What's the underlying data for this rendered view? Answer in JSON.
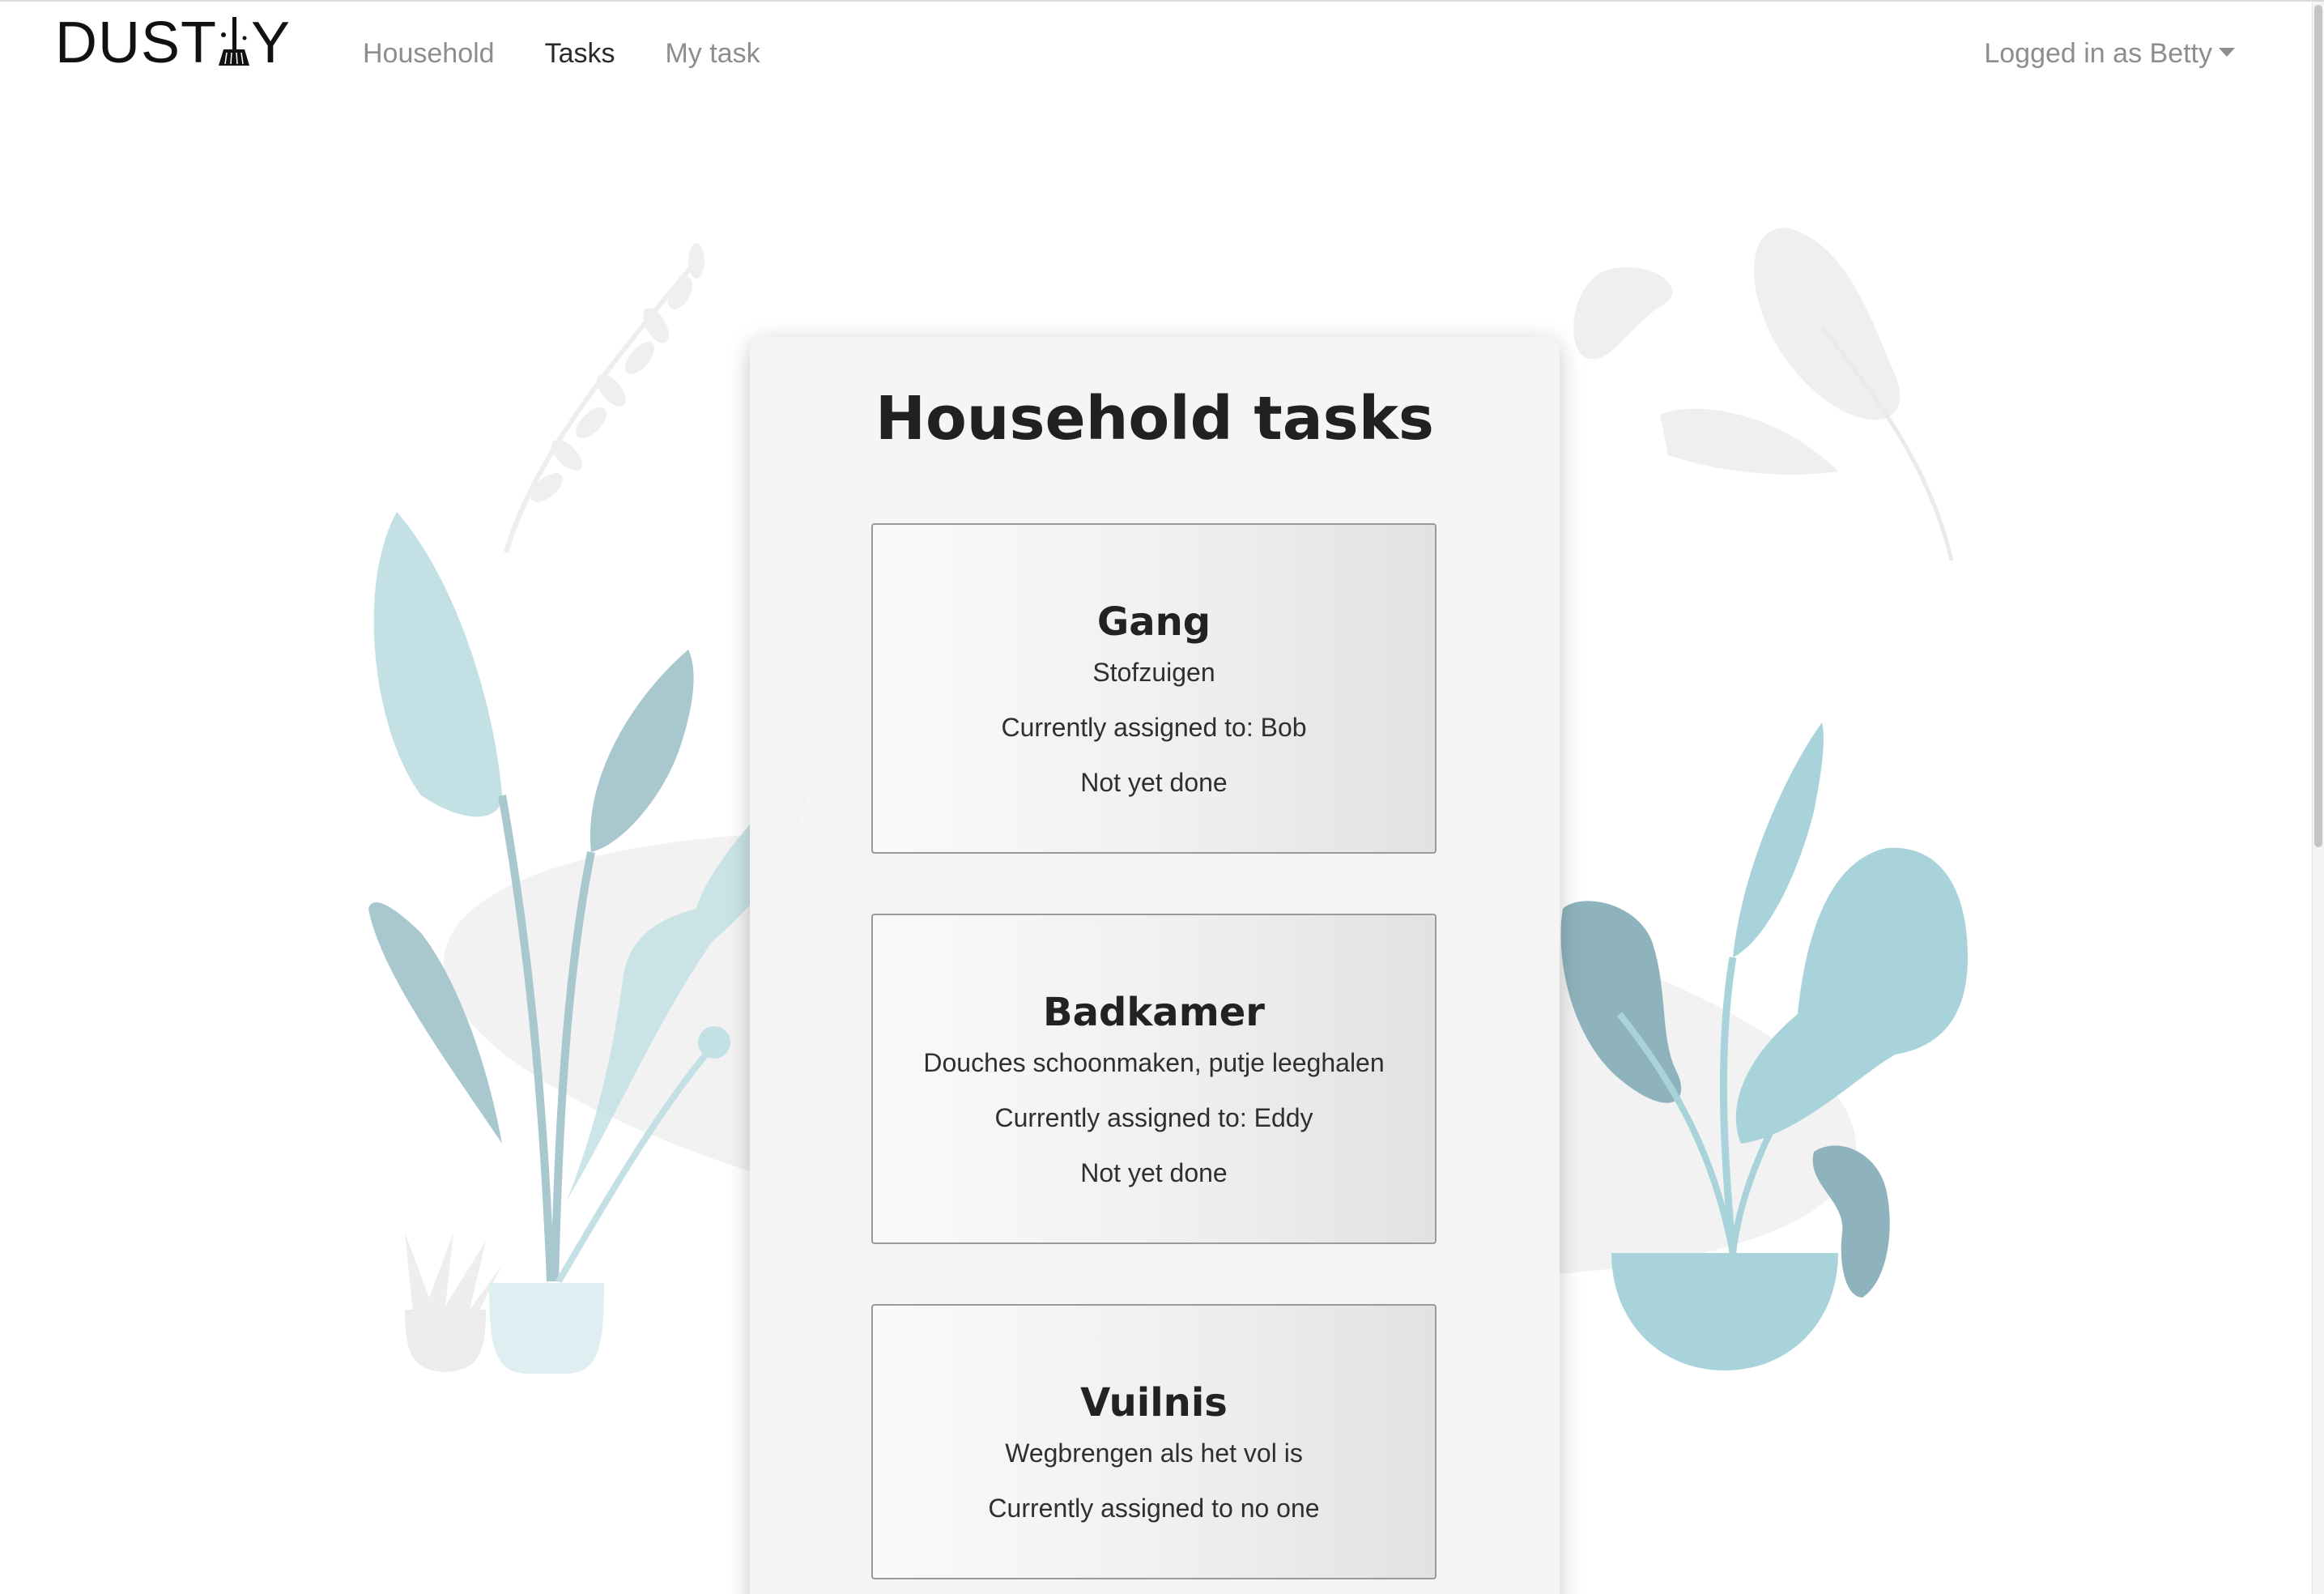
{
  "app": {
    "brand": "DUSTLY",
    "brand_parts": {
      "before": "DUST",
      "after": "Y"
    }
  },
  "nav": {
    "links": [
      {
        "label": "Household",
        "active": false
      },
      {
        "label": "Tasks",
        "active": true
      },
      {
        "label": "My task",
        "active": false
      }
    ],
    "user_menu": "Logged in as Betty"
  },
  "main": {
    "title": "Household tasks",
    "tasks": [
      {
        "name": "Gang",
        "description": "Stofzuigen",
        "assigned": "Currently assigned to: Bob",
        "status": "Not yet done"
      },
      {
        "name": "Badkamer",
        "description": "Douches schoonmaken, putje leeghalen",
        "assigned": "Currently assigned to: Eddy",
        "status": "Not yet done"
      },
      {
        "name": "Vuilnis",
        "description": "Wegbrengen als het vol is",
        "assigned": "Currently assigned to no one"
      }
    ]
  },
  "colors": {
    "plant_light": "#c3e0e5",
    "plant_mid": "#a9d3da",
    "plant_dark": "#93b9c2",
    "plant_grey": "#ececec",
    "text_dark": "#212121",
    "nav_muted": "#8d8d8d"
  },
  "icons": {
    "brand_broom": "broom-icon",
    "user_caret": "caret-down-icon"
  }
}
